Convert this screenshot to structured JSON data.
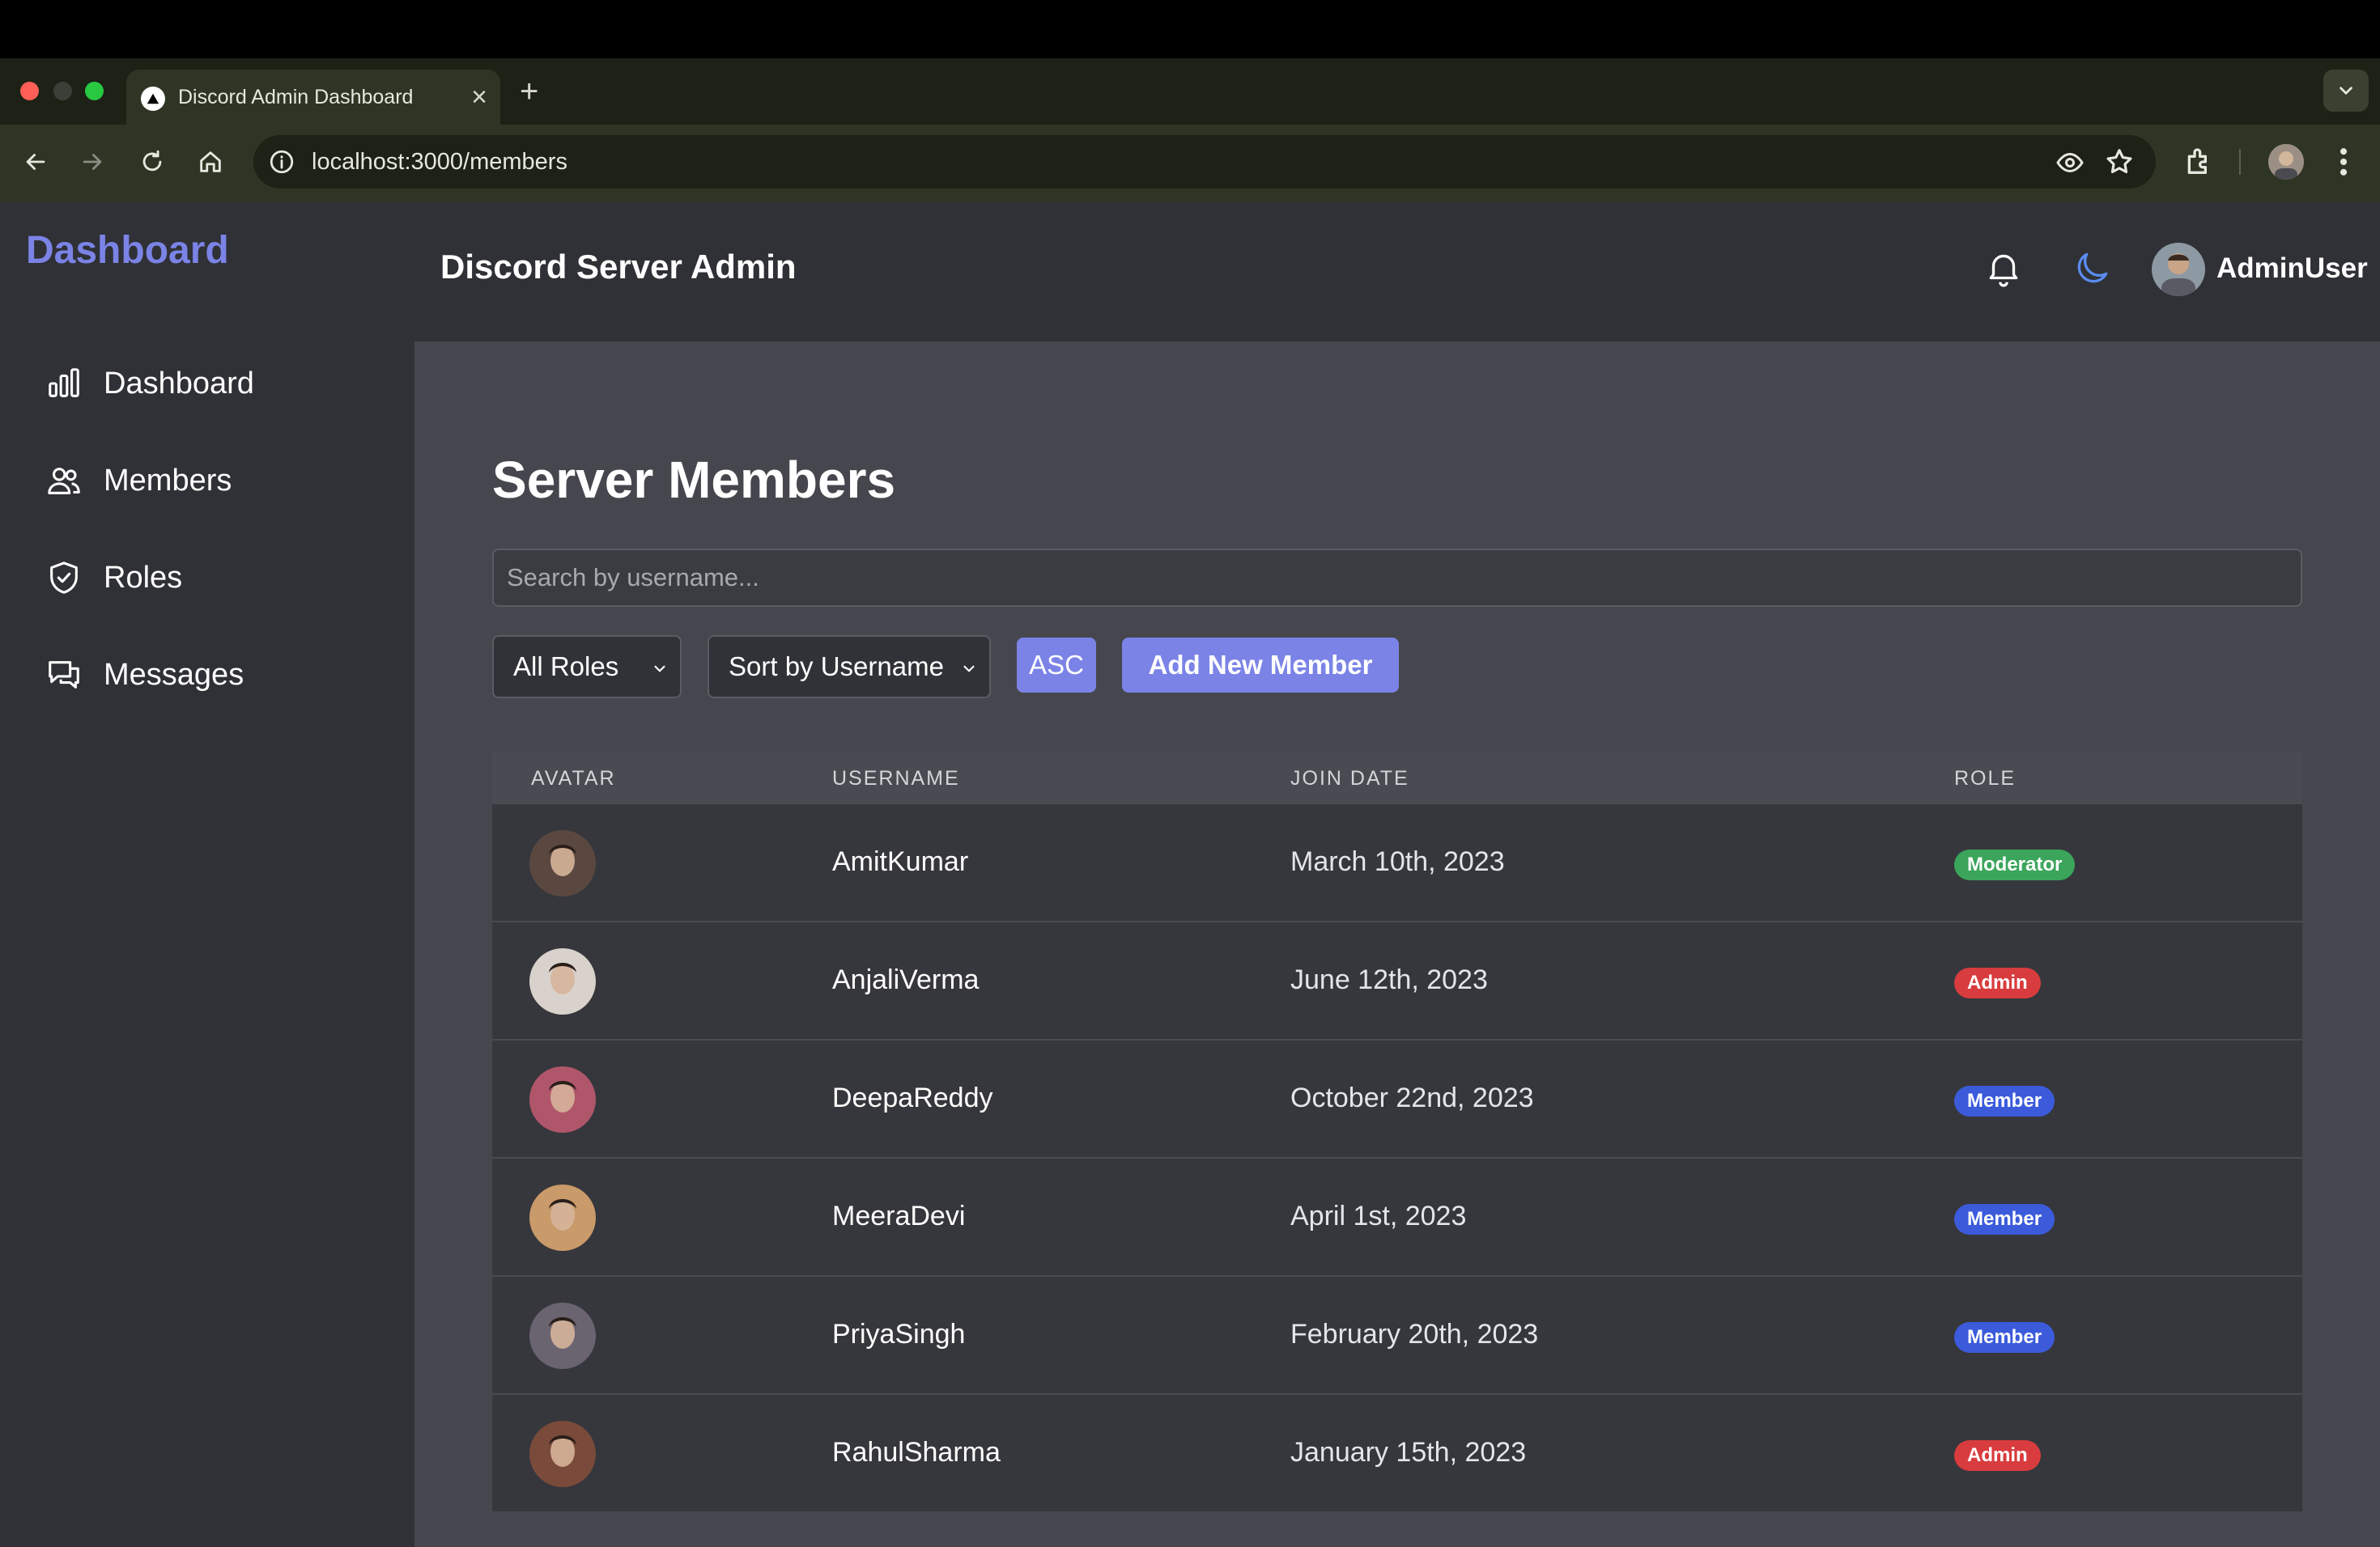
{
  "browser": {
    "tab_title": "Discord Admin Dashboard",
    "tab_close": "×",
    "new_tab": "+",
    "url": "localhost:3000/members"
  },
  "sidebar": {
    "brand": "Dashboard",
    "items": [
      {
        "label": "Dashboard",
        "icon": "bar-chart-icon"
      },
      {
        "label": "Members",
        "icon": "users-icon"
      },
      {
        "label": "Roles",
        "icon": "shield-icon"
      },
      {
        "label": "Messages",
        "icon": "chat-icon"
      }
    ]
  },
  "header": {
    "title": "Discord Server Admin",
    "username": "AdminUser"
  },
  "main": {
    "page_title": "Server Members",
    "search_placeholder": "Search by username...",
    "role_filter": "All Roles",
    "sort_select": "Sort by Username",
    "order_button": "ASC",
    "add_button": "Add New Member",
    "columns": [
      "AVATAR",
      "USERNAME",
      "JOIN DATE",
      "ROLE"
    ],
    "members": [
      {
        "username": "AmitKumar",
        "join_date": "March 10th, 2023",
        "role": "Moderator",
        "role_color": "#3ba55c",
        "avatar_color": "#5a4840"
      },
      {
        "username": "AnjaliVerma",
        "join_date": "June 12th, 2023",
        "role": "Admin",
        "role_color": "#d83c3e",
        "avatar_color": "#d9d2cc"
      },
      {
        "username": "DeepaReddy",
        "join_date": "October 22nd, 2023",
        "role": "Member",
        "role_color": "#3b5bdb",
        "avatar_color": "#b0566a"
      },
      {
        "username": "MeeraDevi",
        "join_date": "April 1st, 2023",
        "role": "Member",
        "role_color": "#3b5bdb",
        "avatar_color": "#c99a6a"
      },
      {
        "username": "PriyaSingh",
        "join_date": "February 20th, 2023",
        "role": "Member",
        "role_color": "#3b5bdb",
        "avatar_color": "#6a6470"
      },
      {
        "username": "RahulSharma",
        "join_date": "January 15th, 2023",
        "role": "Admin",
        "role_color": "#d83c3e",
        "avatar_color": "#7a4a3a"
      }
    ]
  },
  "colors": {
    "accent": "#7b83e6",
    "sidebar_bg": "#2f3136",
    "content_bg": "#46474e"
  }
}
